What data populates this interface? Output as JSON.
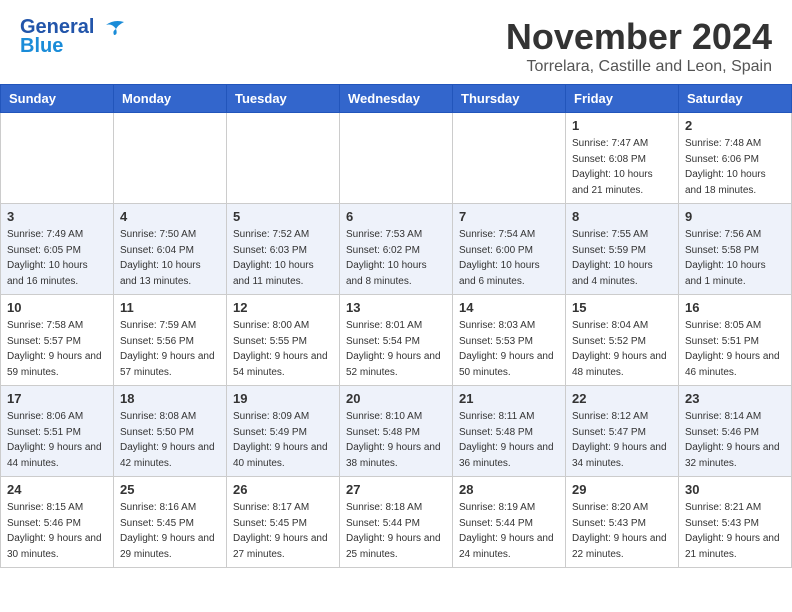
{
  "header": {
    "logo_line1": "General",
    "logo_line2": "Blue",
    "month_title": "November 2024",
    "location": "Torrelara, Castille and Leon, Spain"
  },
  "weekdays": [
    "Sunday",
    "Monday",
    "Tuesday",
    "Wednesday",
    "Thursday",
    "Friday",
    "Saturday"
  ],
  "weeks": [
    {
      "row_style": "white",
      "days": [
        {
          "num": "",
          "info": ""
        },
        {
          "num": "",
          "info": ""
        },
        {
          "num": "",
          "info": ""
        },
        {
          "num": "",
          "info": ""
        },
        {
          "num": "",
          "info": ""
        },
        {
          "num": "1",
          "info": "Sunrise: 7:47 AM\nSunset: 6:08 PM\nDaylight: 10 hours and 21 minutes."
        },
        {
          "num": "2",
          "info": "Sunrise: 7:48 AM\nSunset: 6:06 PM\nDaylight: 10 hours and 18 minutes."
        }
      ]
    },
    {
      "row_style": "light",
      "days": [
        {
          "num": "3",
          "info": "Sunrise: 7:49 AM\nSunset: 6:05 PM\nDaylight: 10 hours and 16 minutes."
        },
        {
          "num": "4",
          "info": "Sunrise: 7:50 AM\nSunset: 6:04 PM\nDaylight: 10 hours and 13 minutes."
        },
        {
          "num": "5",
          "info": "Sunrise: 7:52 AM\nSunset: 6:03 PM\nDaylight: 10 hours and 11 minutes."
        },
        {
          "num": "6",
          "info": "Sunrise: 7:53 AM\nSunset: 6:02 PM\nDaylight: 10 hours and 8 minutes."
        },
        {
          "num": "7",
          "info": "Sunrise: 7:54 AM\nSunset: 6:00 PM\nDaylight: 10 hours and 6 minutes."
        },
        {
          "num": "8",
          "info": "Sunrise: 7:55 AM\nSunset: 5:59 PM\nDaylight: 10 hours and 4 minutes."
        },
        {
          "num": "9",
          "info": "Sunrise: 7:56 AM\nSunset: 5:58 PM\nDaylight: 10 hours and 1 minute."
        }
      ]
    },
    {
      "row_style": "white",
      "days": [
        {
          "num": "10",
          "info": "Sunrise: 7:58 AM\nSunset: 5:57 PM\nDaylight: 9 hours and 59 minutes."
        },
        {
          "num": "11",
          "info": "Sunrise: 7:59 AM\nSunset: 5:56 PM\nDaylight: 9 hours and 57 minutes."
        },
        {
          "num": "12",
          "info": "Sunrise: 8:00 AM\nSunset: 5:55 PM\nDaylight: 9 hours and 54 minutes."
        },
        {
          "num": "13",
          "info": "Sunrise: 8:01 AM\nSunset: 5:54 PM\nDaylight: 9 hours and 52 minutes."
        },
        {
          "num": "14",
          "info": "Sunrise: 8:03 AM\nSunset: 5:53 PM\nDaylight: 9 hours and 50 minutes."
        },
        {
          "num": "15",
          "info": "Sunrise: 8:04 AM\nSunset: 5:52 PM\nDaylight: 9 hours and 48 minutes."
        },
        {
          "num": "16",
          "info": "Sunrise: 8:05 AM\nSunset: 5:51 PM\nDaylight: 9 hours and 46 minutes."
        }
      ]
    },
    {
      "row_style": "light",
      "days": [
        {
          "num": "17",
          "info": "Sunrise: 8:06 AM\nSunset: 5:51 PM\nDaylight: 9 hours and 44 minutes."
        },
        {
          "num": "18",
          "info": "Sunrise: 8:08 AM\nSunset: 5:50 PM\nDaylight: 9 hours and 42 minutes."
        },
        {
          "num": "19",
          "info": "Sunrise: 8:09 AM\nSunset: 5:49 PM\nDaylight: 9 hours and 40 minutes."
        },
        {
          "num": "20",
          "info": "Sunrise: 8:10 AM\nSunset: 5:48 PM\nDaylight: 9 hours and 38 minutes."
        },
        {
          "num": "21",
          "info": "Sunrise: 8:11 AM\nSunset: 5:48 PM\nDaylight: 9 hours and 36 minutes."
        },
        {
          "num": "22",
          "info": "Sunrise: 8:12 AM\nSunset: 5:47 PM\nDaylight: 9 hours and 34 minutes."
        },
        {
          "num": "23",
          "info": "Sunrise: 8:14 AM\nSunset: 5:46 PM\nDaylight: 9 hours and 32 minutes."
        }
      ]
    },
    {
      "row_style": "white",
      "days": [
        {
          "num": "24",
          "info": "Sunrise: 8:15 AM\nSunset: 5:46 PM\nDaylight: 9 hours and 30 minutes."
        },
        {
          "num": "25",
          "info": "Sunrise: 8:16 AM\nSunset: 5:45 PM\nDaylight: 9 hours and 29 minutes."
        },
        {
          "num": "26",
          "info": "Sunrise: 8:17 AM\nSunset: 5:45 PM\nDaylight: 9 hours and 27 minutes."
        },
        {
          "num": "27",
          "info": "Sunrise: 8:18 AM\nSunset: 5:44 PM\nDaylight: 9 hours and 25 minutes."
        },
        {
          "num": "28",
          "info": "Sunrise: 8:19 AM\nSunset: 5:44 PM\nDaylight: 9 hours and 24 minutes."
        },
        {
          "num": "29",
          "info": "Sunrise: 8:20 AM\nSunset: 5:43 PM\nDaylight: 9 hours and 22 minutes."
        },
        {
          "num": "30",
          "info": "Sunrise: 8:21 AM\nSunset: 5:43 PM\nDaylight: 9 hours and 21 minutes."
        }
      ]
    }
  ]
}
